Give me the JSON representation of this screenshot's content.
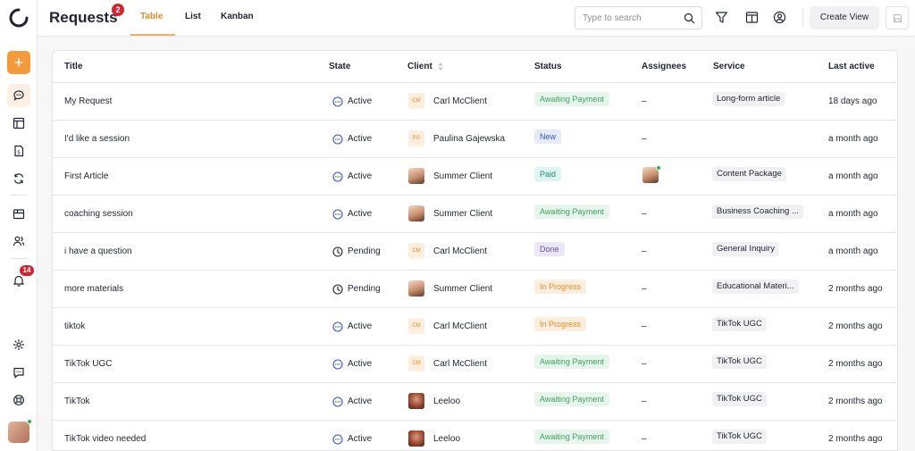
{
  "header": {
    "title": "Requests",
    "title_badge": "2",
    "tabs": [
      {
        "label": "Table",
        "active": true
      },
      {
        "label": "List",
        "active": false
      },
      {
        "label": "Kanban",
        "active": false
      }
    ],
    "search_placeholder": "Type to search",
    "create_view_label": "Create View"
  },
  "sidebar": {
    "notification_count": "14",
    "accent_color": "#f39a3a"
  },
  "table": {
    "columns": [
      "Title",
      "State",
      "Client",
      "Status",
      "Assignees",
      "Service",
      "Last active"
    ],
    "rows": [
      {
        "title": "My Request",
        "state": "Active",
        "state_icon": "active-icon",
        "client_initials": "CM",
        "client_avatar": "initials",
        "client": "Carl McClient",
        "status": "Awaiting Payment",
        "status_kind": "await",
        "assignee": "–",
        "service": "Long-form article",
        "last_active": "18 days ago"
      },
      {
        "title": "I'd like a session",
        "state": "Active",
        "state_icon": "active-icon",
        "client_initials": "PG",
        "client_avatar": "initials",
        "client": "Paulina Gajewska",
        "status": "New",
        "status_kind": "new",
        "assignee": "–",
        "service": "",
        "last_active": "a month ago"
      },
      {
        "title": "First Article",
        "state": "Active",
        "state_icon": "active-icon",
        "client_initials": "",
        "client_avatar": "summer",
        "client": "Summer Client",
        "status": "Paid",
        "status_kind": "paid",
        "assignee": "avatar",
        "service": "Content Package",
        "last_active": "a month ago"
      },
      {
        "title": "coaching session",
        "state": "Active",
        "state_icon": "active-icon",
        "client_initials": "",
        "client_avatar": "summer",
        "client": "Summer Client",
        "status": "Awaiting Payment",
        "status_kind": "await",
        "assignee": "–",
        "service": "Business Coaching ...",
        "last_active": "a month ago"
      },
      {
        "title": "i have a question",
        "state": "Pending",
        "state_icon": "pending-icon",
        "client_initials": "CM",
        "client_avatar": "initials",
        "client": "Carl McClient",
        "status": "Done",
        "status_kind": "done",
        "assignee": "–",
        "service": "General Inquiry",
        "last_active": "a month ago"
      },
      {
        "title": "more materials",
        "state": "Pending",
        "state_icon": "pending-icon",
        "client_initials": "",
        "client_avatar": "summer",
        "client": "Summer Client",
        "status": "In Progress",
        "status_kind": "prog",
        "assignee": "–",
        "service": "Educational Materi...",
        "last_active": "2 months ago"
      },
      {
        "title": "tiktok",
        "state": "Active",
        "state_icon": "active-icon",
        "client_initials": "CM",
        "client_avatar": "initials",
        "client": "Carl McClient",
        "status": "In Progress",
        "status_kind": "prog",
        "assignee": "–",
        "service": "TikTok UGC",
        "last_active": "2 months ago"
      },
      {
        "title": "TikTok UGC",
        "state": "Active",
        "state_icon": "active-icon",
        "client_initials": "CM",
        "client_avatar": "initials",
        "client": "Carl McClient",
        "status": "Awaiting Payment",
        "status_kind": "await",
        "assignee": "–",
        "service": "TikTok UGC",
        "last_active": "2 months ago"
      },
      {
        "title": "TikTok",
        "state": "Active",
        "state_icon": "active-icon",
        "client_initials": "",
        "client_avatar": "leeloo",
        "client": "Leeloo",
        "status": "Awaiting Payment",
        "status_kind": "await",
        "assignee": "–",
        "service": "TikTok UGC",
        "last_active": "2 months ago"
      },
      {
        "title": "TikTok video needed",
        "state": "Active",
        "state_icon": "active-icon",
        "client_initials": "",
        "client_avatar": "leeloo",
        "client": "Leeloo",
        "status": "Awaiting Payment",
        "status_kind": "await",
        "assignee": "–",
        "service": "TikTok UGC",
        "last_active": "2 months ago"
      }
    ]
  }
}
